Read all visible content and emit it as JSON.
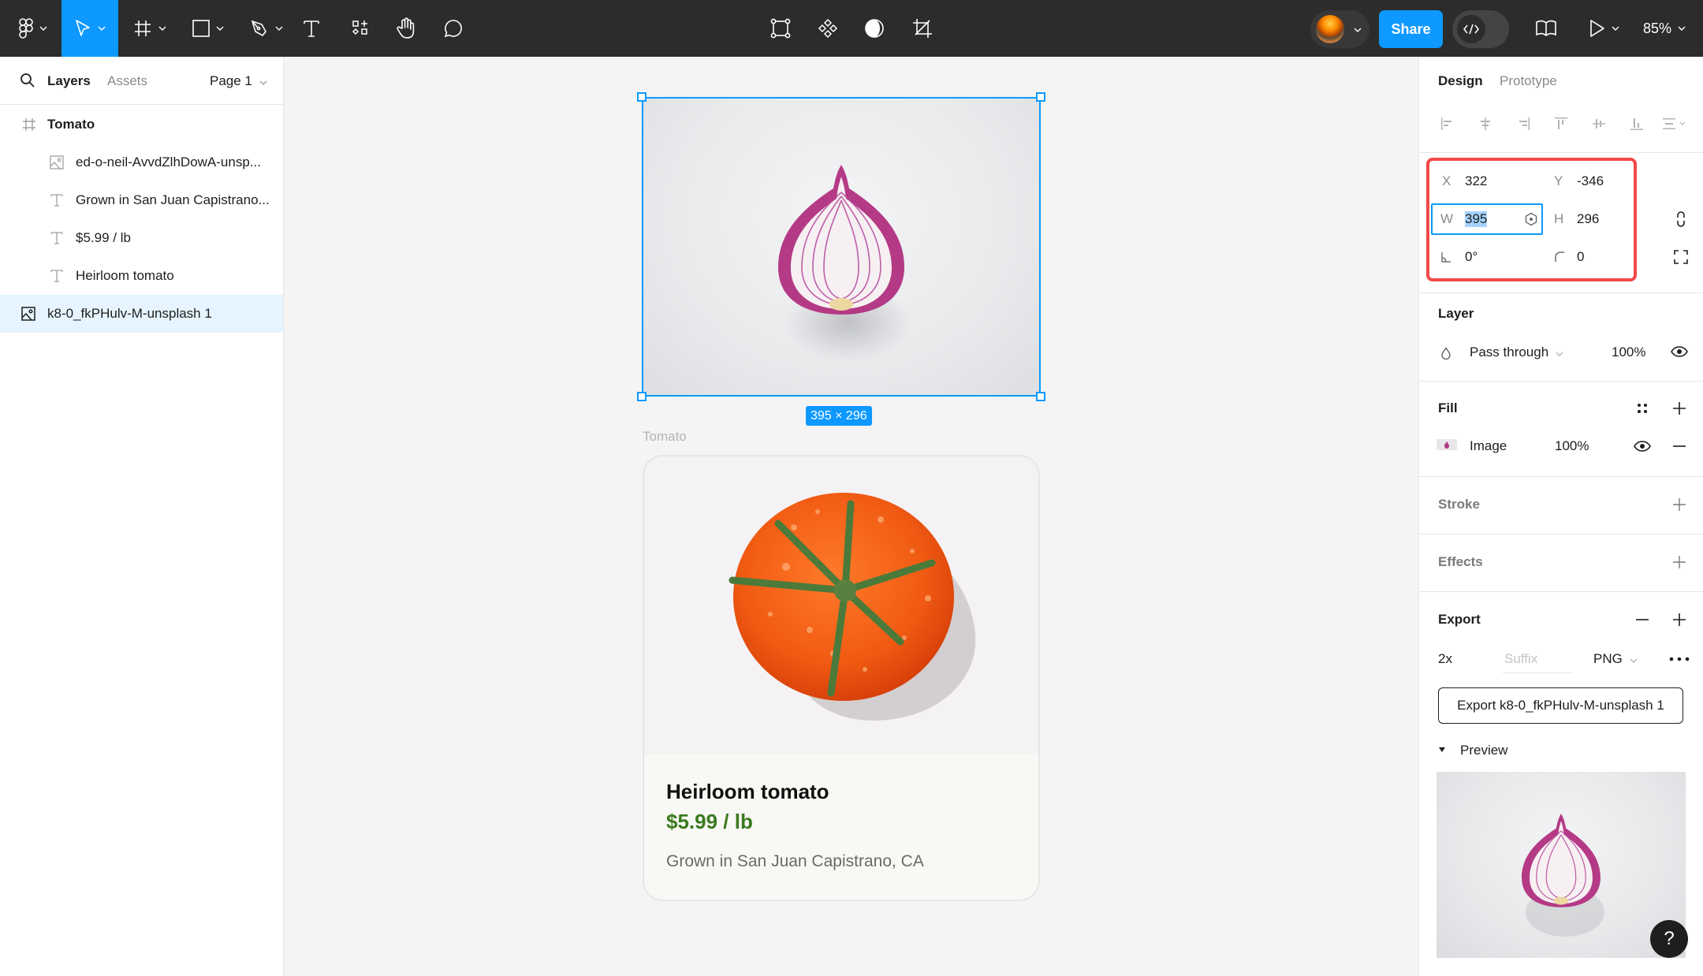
{
  "toolbar": {
    "tools": [
      {
        "name": "main-menu",
        "icon": "figma-logo-icon",
        "has_dropdown": true
      },
      {
        "name": "move",
        "icon": "cursor-arrow-icon",
        "has_dropdown": true,
        "active": true
      },
      {
        "name": "frame",
        "icon": "frame-hash-icon",
        "has_dropdown": true
      },
      {
        "name": "shape",
        "icon": "rectangle-icon",
        "has_dropdown": true
      },
      {
        "name": "pen",
        "icon": "pen-icon",
        "has_dropdown": true
      },
      {
        "name": "text",
        "icon": "text-icon",
        "has_dropdown": false
      },
      {
        "name": "resources",
        "icon": "resources-icon",
        "has_dropdown": false
      },
      {
        "name": "hand",
        "icon": "hand-icon",
        "has_dropdown": false
      },
      {
        "name": "comment",
        "icon": "comment-icon",
        "has_dropdown": false
      }
    ],
    "center_tools": [
      {
        "name": "edit-object",
        "icon": "vector-edit-icon"
      },
      {
        "name": "component",
        "icon": "component-icon"
      },
      {
        "name": "mask",
        "icon": "mask-icon"
      },
      {
        "name": "crop",
        "icon": "crop-icon"
      }
    ],
    "share_label": "Share",
    "dev_mode_icon": "code-icon",
    "library_icon": "book-icon",
    "present_icon": "play-icon",
    "zoom_level": "85%",
    "accent_color": "#0d99ff"
  },
  "left_panel": {
    "tabs": [
      {
        "label": "Layers",
        "active": true
      },
      {
        "label": "Assets",
        "active": false
      }
    ],
    "page": "Page 1",
    "layers": [
      {
        "label": "Tomato",
        "type": "frame",
        "indent": 0,
        "bold": true,
        "selected": false
      },
      {
        "label": "ed-o-neil-AvvdZlhDowA-unsp...",
        "type": "image",
        "indent": 1,
        "selected": false
      },
      {
        "label": "Grown in San Juan Capistrano...",
        "type": "text",
        "indent": 1,
        "selected": false
      },
      {
        "label": "$5.99 / lb",
        "type": "text",
        "indent": 1,
        "selected": false
      },
      {
        "label": "Heirloom tomato",
        "type": "text",
        "indent": 1,
        "selected": false
      },
      {
        "label": "k8-0_fkPHulv-M-unsplash 1",
        "type": "image",
        "indent": 0,
        "selected": true
      }
    ]
  },
  "canvas": {
    "selection_dimensions": "395 × 296",
    "frame_label": "Tomato",
    "card": {
      "title": "Heirloom tomato",
      "price": "$5.99 / lb",
      "description": "Grown in San Juan Capistrano, CA",
      "price_color": "#3a7a1f"
    }
  },
  "right_panel": {
    "tabs": [
      {
        "label": "Design",
        "active": true
      },
      {
        "label": "Prototype",
        "active": false
      }
    ],
    "position": {
      "x_label": "X",
      "x": "322",
      "y_label": "Y",
      "y": "-346",
      "w_label": "W",
      "w": "395",
      "h_label": "H",
      "h": "296",
      "rotation": "0°",
      "corner_radius": "0"
    },
    "layer": {
      "title": "Layer",
      "blend_mode": "Pass through",
      "opacity": "100%"
    },
    "fill": {
      "title": "Fill",
      "type": "Image",
      "opacity": "100%"
    },
    "stroke": {
      "title": "Stroke"
    },
    "effects": {
      "title": "Effects"
    },
    "export": {
      "title": "Export",
      "scale": "2x",
      "suffix_placeholder": "Suffix",
      "format": "PNG",
      "button_label": "Export k8-0_fkPHulv-M-unsplash 1",
      "preview_label": "Preview"
    },
    "help_label": "?"
  }
}
